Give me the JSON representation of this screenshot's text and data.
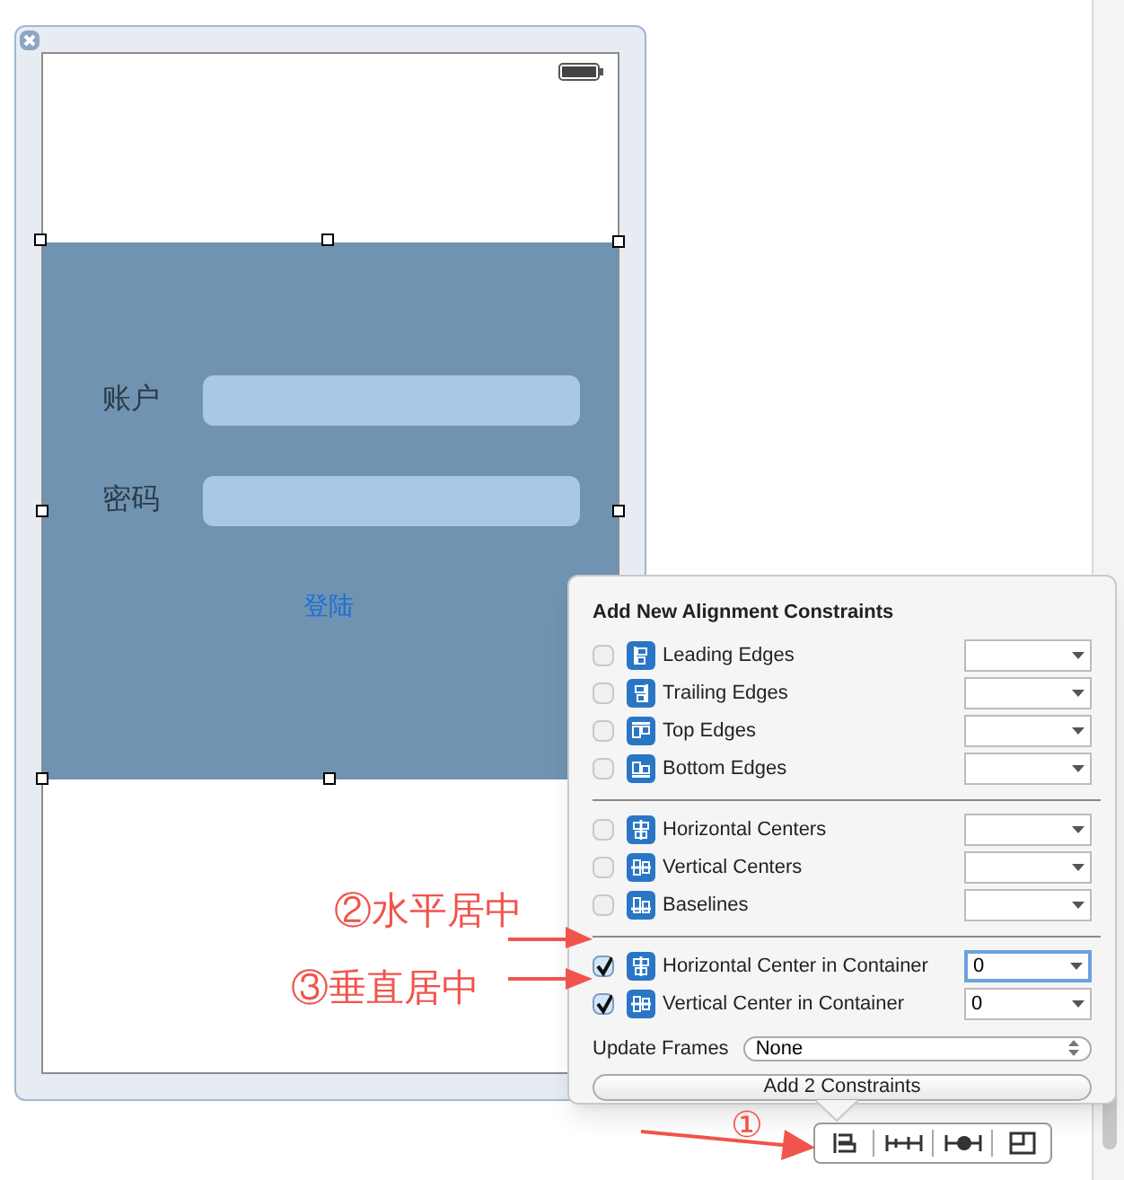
{
  "scene": {
    "fields": [
      {
        "label": "账户"
      },
      {
        "label": "密码"
      }
    ],
    "login_button": "登陆"
  },
  "popover": {
    "title": "Add New Alignment Constraints",
    "groups": [
      [
        {
          "label": "Leading Edges",
          "checked": false
        },
        {
          "label": "Trailing Edges",
          "checked": false
        },
        {
          "label": "Top Edges",
          "checked": false
        },
        {
          "label": "Bottom Edges",
          "checked": false
        }
      ],
      [
        {
          "label": "Horizontal Centers",
          "checked": false
        },
        {
          "label": "Vertical Centers",
          "checked": false
        },
        {
          "label": "Baselines",
          "checked": false
        }
      ],
      [
        {
          "label": "Horizontal Center in Container",
          "checked": true,
          "value": "0",
          "focused": true
        },
        {
          "label": "Vertical Center in Container",
          "checked": true,
          "value": "0",
          "focused": false
        }
      ]
    ],
    "update_frames": {
      "label": "Update Frames",
      "value": "None"
    },
    "add_button": "Add 2 Constraints"
  },
  "annotations": [
    {
      "text": "②水平居中"
    },
    {
      "text": "③垂直居中"
    },
    {
      "text": "①"
    }
  ]
}
